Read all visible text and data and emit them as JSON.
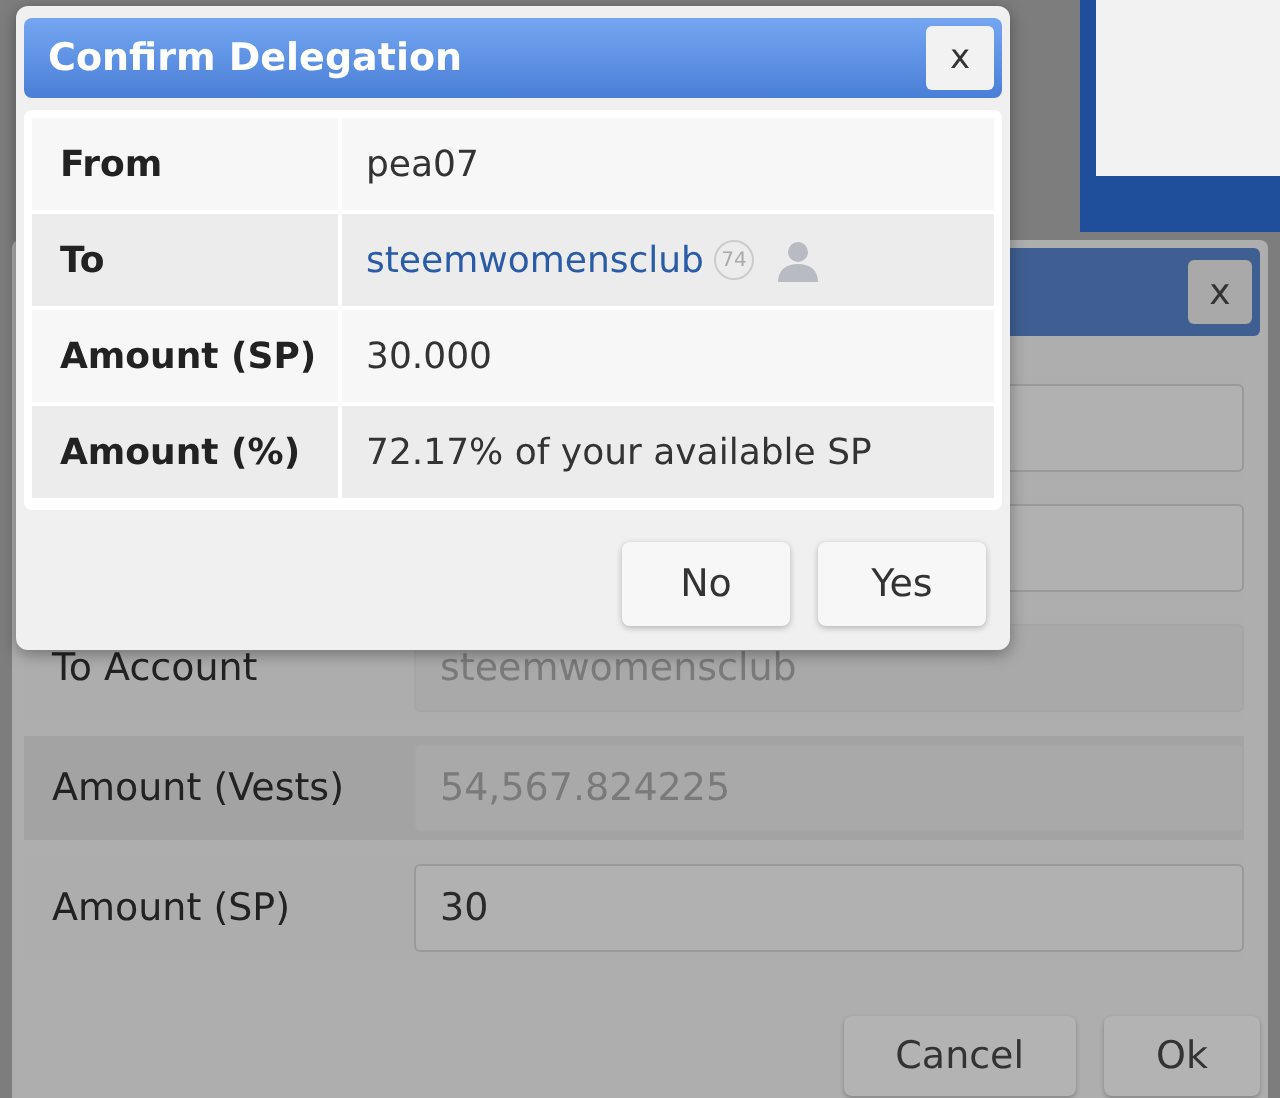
{
  "background_dialog": {
    "close_label": "x",
    "rows": [
      {
        "kind": "blank"
      },
      {
        "kind": "blank"
      },
      {
        "kind": "field",
        "label": "To Account",
        "value": "steemwomensclub",
        "disabled": true
      },
      {
        "kind": "field",
        "label": "Amount (Vests)",
        "value": "54,567.824225",
        "disabled": true
      },
      {
        "kind": "field",
        "label": "Amount (SP)",
        "value": "30",
        "disabled": false
      }
    ],
    "buttons": [
      "Cancel",
      "Ok"
    ]
  },
  "confirm_dialog": {
    "title": "Confirm Delegation",
    "close_label": "x",
    "rows": [
      {
        "label": "From",
        "value": "pea07",
        "kind": "text"
      },
      {
        "label": "To",
        "value": "steemwomensclub",
        "kind": "account",
        "reputation": "74"
      },
      {
        "label": "Amount (SP)",
        "value": "30.000",
        "kind": "text"
      },
      {
        "label": "Amount (%)",
        "value": "72.17% of your available SP",
        "kind": "text"
      }
    ],
    "buttons": [
      "No",
      "Yes"
    ]
  }
}
